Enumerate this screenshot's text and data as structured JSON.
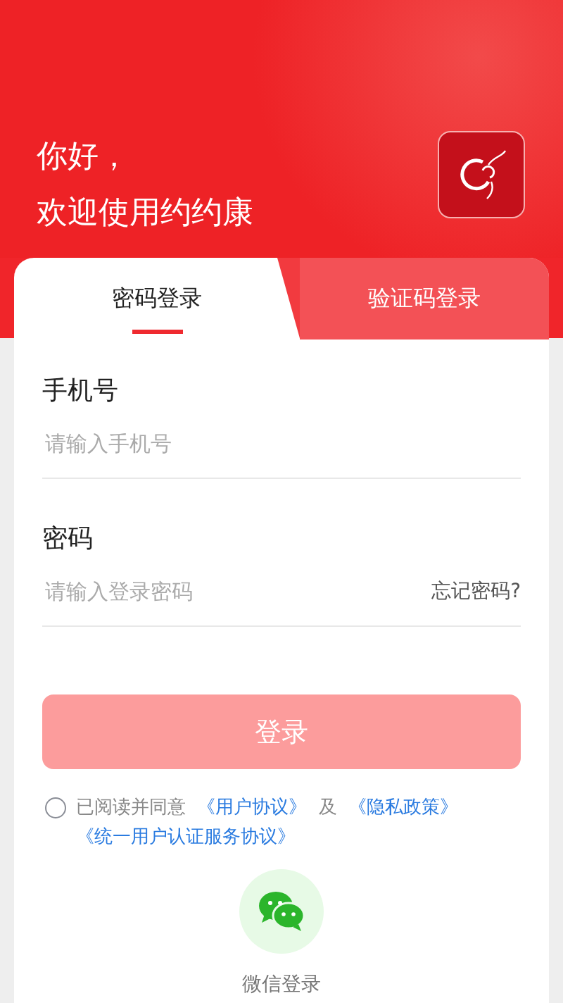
{
  "greeting": [
    "你好，",
    "欢迎使用约约康"
  ],
  "tabs": [
    {
      "label": "密码登录",
      "selected": true
    },
    {
      "label": "验证码登录",
      "selected": false
    }
  ],
  "fields": [
    {
      "label": "手机号",
      "placeholder": "请输入手机号"
    },
    {
      "label": "密码",
      "placeholder": "请输入登录密码",
      "link": "忘记密码?"
    }
  ],
  "login_button": {
    "label": "登录",
    "disabled": true
  },
  "agreement": {
    "checked": false,
    "parts": [
      {
        "kind": "text",
        "text": "已阅读并同意"
      },
      {
        "kind": "link",
        "text": "《用户协议》"
      },
      {
        "kind": "text",
        "text": "及"
      },
      {
        "kind": "link",
        "text": "《隐私政策》"
      },
      {
        "kind": "link",
        "text": "《统一用户认证服务协议》"
      }
    ]
  },
  "wechat_login": {
    "label": "微信登录"
  }
}
